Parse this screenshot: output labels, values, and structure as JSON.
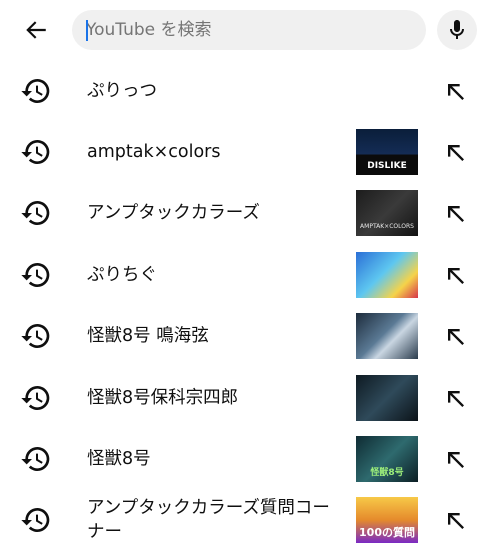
{
  "search": {
    "placeholder": "YouTube を検索",
    "value": ""
  },
  "icons": {
    "back": "arrow-back-icon",
    "mic": "microphone-icon",
    "history": "history-icon",
    "fill": "arrow-up-left-icon"
  },
  "colors": {
    "text": "#0f0f0f",
    "search_bg": "#f0f0f0",
    "caret": "#1a73e8"
  },
  "suggestions": [
    {
      "label": "ぷりっつ",
      "thumbnail": false
    },
    {
      "label": "amptak×colors",
      "thumbnail": true,
      "thumb_text": "DISLIKE"
    },
    {
      "label": "アンプタックカラーズ",
      "thumbnail": true,
      "thumb_text": "AMPTAK×COLORS"
    },
    {
      "label": "ぷりちぐ",
      "thumbnail": true,
      "thumb_text": ""
    },
    {
      "label": "怪獣8号 鳴海弦",
      "thumbnail": true,
      "thumb_text": ""
    },
    {
      "label": "怪獣8号保科宗四郎",
      "thumbnail": true,
      "thumb_text": ""
    },
    {
      "label": "怪獣8号",
      "thumbnail": true,
      "thumb_text": "怪獣8号"
    },
    {
      "label": "アンプタックカラーズ質問コーナー",
      "thumbnail": true,
      "thumb_text": "100の質問"
    }
  ]
}
